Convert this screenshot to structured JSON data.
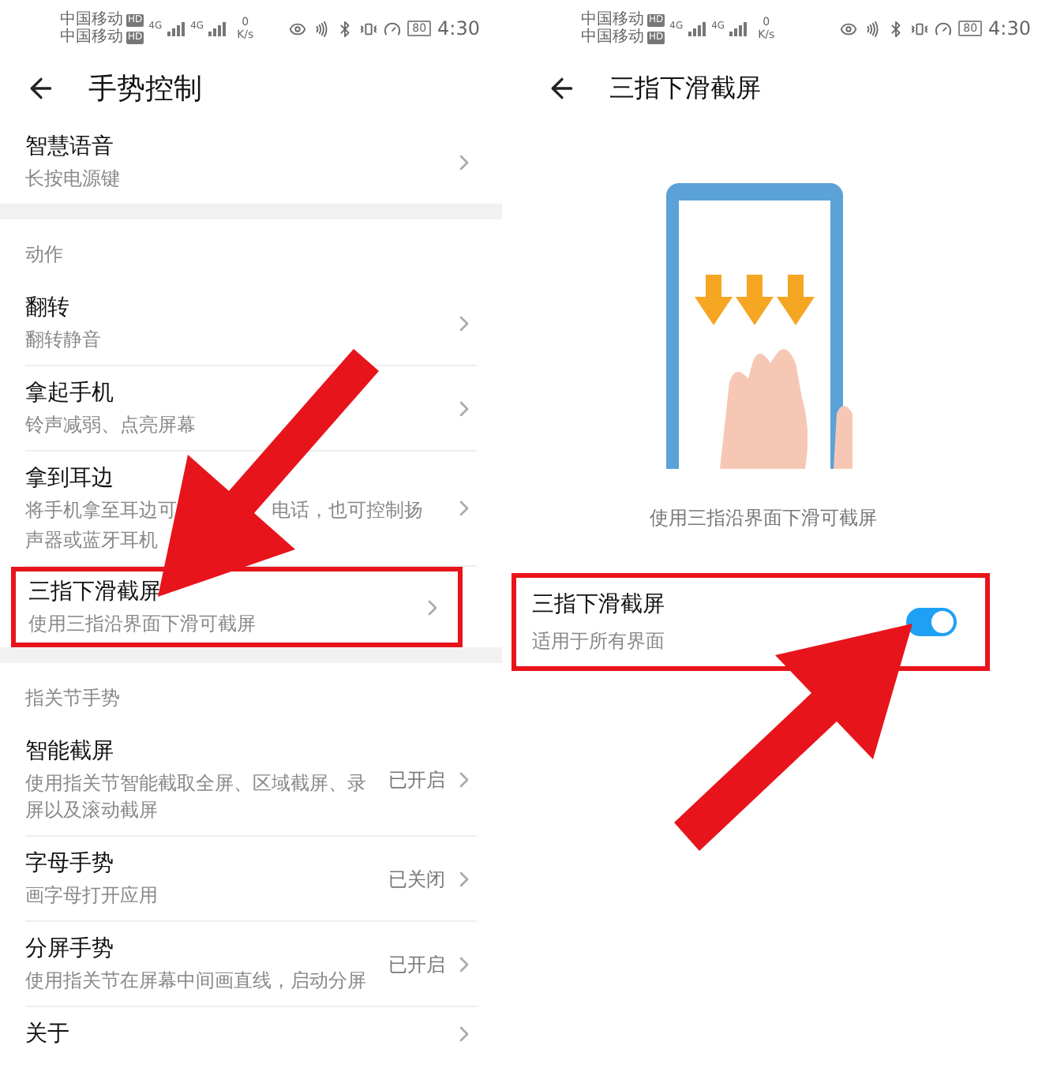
{
  "left_screen": {
    "status_bar": {
      "carrier": "中国移动",
      "carrier_2": "中国移动",
      "hd": "HD",
      "hd_2": "HD",
      "network": "4G",
      "network_2": "4G",
      "speed": "0",
      "speed_unit": "K/s",
      "battery": "80",
      "time": "4:30"
    },
    "title": "手势控制",
    "sections": [
      {
        "items": [
          {
            "title": "智慧语音",
            "subtitle": "长按电源键"
          }
        ]
      },
      {
        "header": "动作",
        "items": [
          {
            "title": "翻转",
            "subtitle": "翻转静音"
          },
          {
            "title": "拿起手机",
            "subtitle": "铃声减弱、点亮屏幕"
          },
          {
            "title": "拿到耳边",
            "subtitle_lines": [
              [
                "将手机拿至耳边可",
                "电话，也可控制扬"
              ],
              [
                "声器或蓝牙耳机"
              ]
            ]
          },
          {
            "title": "三指下滑截屏",
            "subtitle": "使用三指沿界面下滑可截屏",
            "highlighted": true
          }
        ]
      },
      {
        "header": "指关节手势",
        "items": [
          {
            "title": "智能截屏",
            "subtitle": "使用指关节智能截取全屏、区域截屏、录屏以及滚动截屏",
            "value": "已开启"
          },
          {
            "title": "字母手势",
            "subtitle": "画字母打开应用",
            "value": "已关闭"
          },
          {
            "title": "分屏手势",
            "subtitle": "使用指关节在屏幕中间画直线，启动分屏",
            "value": "已开启"
          },
          {
            "title": "关于"
          }
        ]
      }
    ]
  },
  "right_screen": {
    "status_bar": {
      "carrier": "中国移动",
      "carrier_2": "中国移动",
      "hd": "HD",
      "hd_2": "HD",
      "network": "4G",
      "network_2": "4G",
      "speed": "0",
      "speed_unit": "K/s",
      "battery": "80",
      "time": "4:30"
    },
    "title": "三指下滑截屏",
    "caption": "使用三指沿界面下滑可截屏",
    "setting": {
      "title": "三指下滑截屏",
      "subtitle": "适用于所有界面",
      "on": true,
      "highlighted": true
    }
  }
}
